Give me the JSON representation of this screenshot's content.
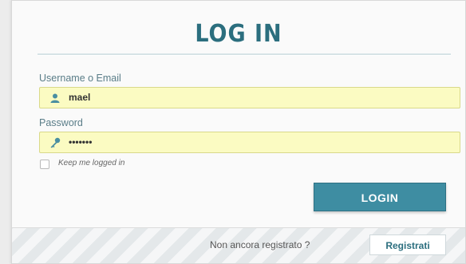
{
  "title": "LOG IN",
  "username": {
    "label": "Username o Email",
    "value": "mael",
    "icon": "user-icon"
  },
  "password": {
    "label": "Password",
    "value": "•••••••",
    "icon": "key-icon"
  },
  "remember": {
    "label": "Keep me logged in",
    "checked": false
  },
  "login_button": "LOGIN",
  "footer": {
    "text": "Non ancora registrato ?",
    "register_button": "Registrati"
  },
  "colors": {
    "accent": "#3e8da2",
    "title": "#2b6e7e",
    "field_bg": "#fbfbc2"
  }
}
